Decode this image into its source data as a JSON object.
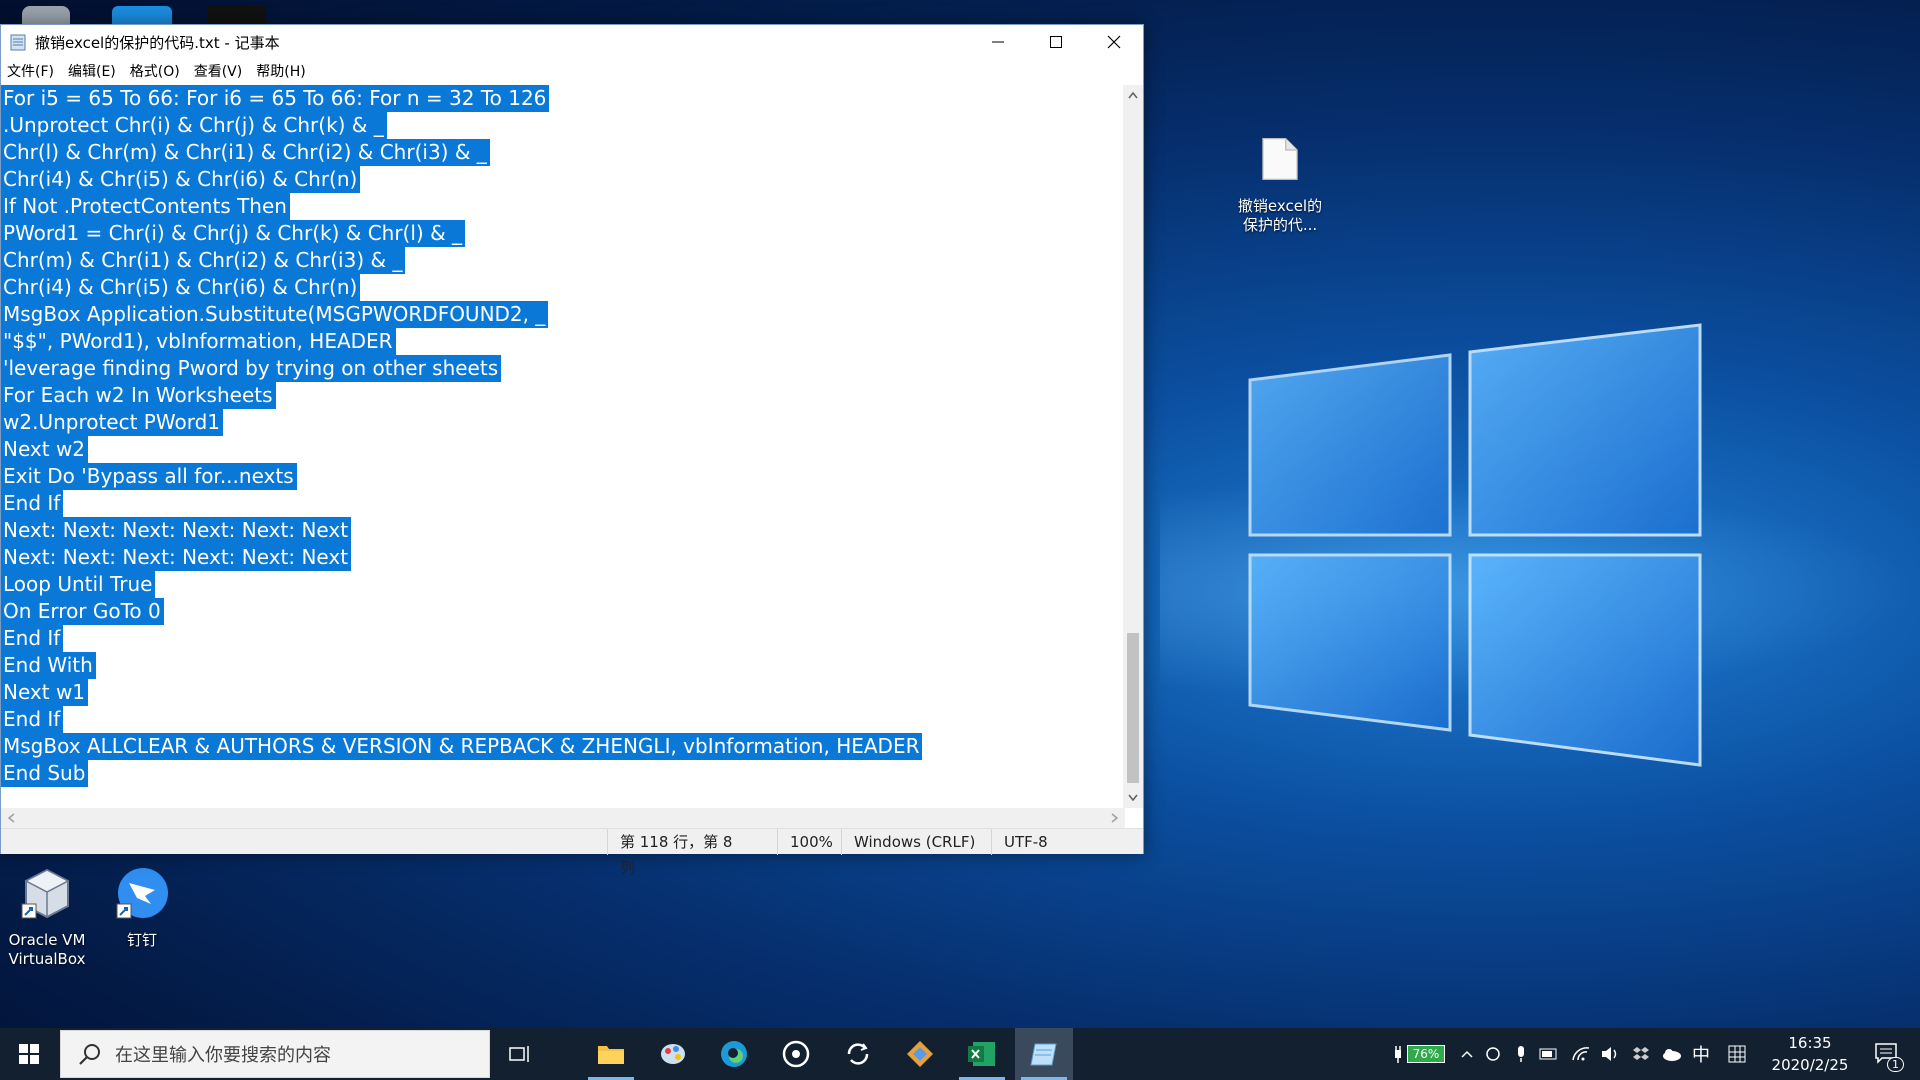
{
  "window": {
    "title": "撤销excel的保护的代码.txt - 记事本",
    "menu": [
      "文件(F)",
      "编辑(E)",
      "格式(O)",
      "查看(V)",
      "帮助(H)"
    ],
    "lines": [
      "For i5 = 65 To 66: For i6 = 65 To 66: For n = 32 To 126",
      ".Unprotect Chr(i) & Chr(j) & Chr(k) & _",
      "Chr(l) & Chr(m) & Chr(i1) & Chr(i2) & Chr(i3) & _",
      "Chr(i4) & Chr(i5) & Chr(i6) & Chr(n)",
      "If Not .ProtectContents Then",
      "PWord1 = Chr(i) & Chr(j) & Chr(k) & Chr(l) & _",
      "Chr(m) & Chr(i1) & Chr(i2) & Chr(i3) & _",
      "Chr(i4) & Chr(i5) & Chr(i6) & Chr(n)",
      "MsgBox Application.Substitute(MSGPWORDFOUND2, _",
      "\"$$\", PWord1), vbInformation, HEADER",
      "'leverage finding Pword by trying on other sheets",
      "For Each w2 In Worksheets",
      "w2.Unprotect PWord1",
      "Next w2",
      "Exit Do 'Bypass all for...nexts",
      "End If",
      "Next: Next: Next: Next: Next: Next",
      "Next: Next: Next: Next: Next: Next",
      "Loop Until True",
      "On Error GoTo 0",
      "End If",
      "End With",
      "Next w1",
      "End If",
      "MsgBox ALLCLEAR & AUTHORS & VERSION & REPBACK & ZHENGLI, vbInformation, HEADER",
      "End Sub"
    ],
    "status": {
      "position": "第 118 行，第 8 列",
      "zoom": "100%",
      "line_ending": "Windows (CRLF)",
      "encoding": "UTF-8"
    }
  },
  "desktop": {
    "file_icon_label": "撤销excel的保护的代...",
    "vbox_label": "Oracle VM VirtualBox",
    "dingtalk_label": "钉钉"
  },
  "taskbar": {
    "search_placeholder": "在这里输入你要搜索的内容",
    "battery": "76%",
    "ime": "中",
    "time": "16:35",
    "date": "2020/2/25",
    "notification_count": "1"
  },
  "colors": {
    "selection": "#0a78d7",
    "taskbar": "#13202f"
  }
}
